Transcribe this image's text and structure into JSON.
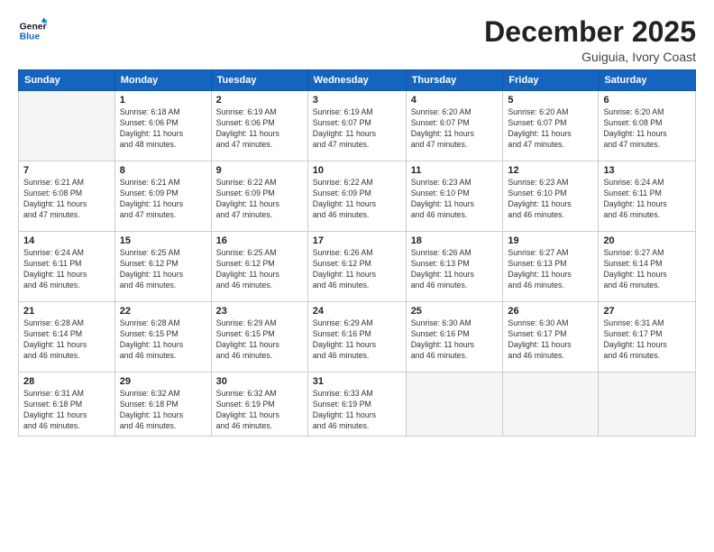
{
  "logo": {
    "line1": "General",
    "line2": "Blue"
  },
  "title": "December 2025",
  "subtitle": "Guiguia, Ivory Coast",
  "days_header": [
    "Sunday",
    "Monday",
    "Tuesday",
    "Wednesday",
    "Thursday",
    "Friday",
    "Saturday"
  ],
  "weeks": [
    [
      {
        "num": "",
        "info": ""
      },
      {
        "num": "1",
        "info": "Sunrise: 6:18 AM\nSunset: 6:06 PM\nDaylight: 11 hours\nand 48 minutes."
      },
      {
        "num": "2",
        "info": "Sunrise: 6:19 AM\nSunset: 6:06 PM\nDaylight: 11 hours\nand 47 minutes."
      },
      {
        "num": "3",
        "info": "Sunrise: 6:19 AM\nSunset: 6:07 PM\nDaylight: 11 hours\nand 47 minutes."
      },
      {
        "num": "4",
        "info": "Sunrise: 6:20 AM\nSunset: 6:07 PM\nDaylight: 11 hours\nand 47 minutes."
      },
      {
        "num": "5",
        "info": "Sunrise: 6:20 AM\nSunset: 6:07 PM\nDaylight: 11 hours\nand 47 minutes."
      },
      {
        "num": "6",
        "info": "Sunrise: 6:20 AM\nSunset: 6:08 PM\nDaylight: 11 hours\nand 47 minutes."
      }
    ],
    [
      {
        "num": "7",
        "info": "Sunrise: 6:21 AM\nSunset: 6:08 PM\nDaylight: 11 hours\nand 47 minutes."
      },
      {
        "num": "8",
        "info": "Sunrise: 6:21 AM\nSunset: 6:09 PM\nDaylight: 11 hours\nand 47 minutes."
      },
      {
        "num": "9",
        "info": "Sunrise: 6:22 AM\nSunset: 6:09 PM\nDaylight: 11 hours\nand 47 minutes."
      },
      {
        "num": "10",
        "info": "Sunrise: 6:22 AM\nSunset: 6:09 PM\nDaylight: 11 hours\nand 46 minutes."
      },
      {
        "num": "11",
        "info": "Sunrise: 6:23 AM\nSunset: 6:10 PM\nDaylight: 11 hours\nand 46 minutes."
      },
      {
        "num": "12",
        "info": "Sunrise: 6:23 AM\nSunset: 6:10 PM\nDaylight: 11 hours\nand 46 minutes."
      },
      {
        "num": "13",
        "info": "Sunrise: 6:24 AM\nSunset: 6:11 PM\nDaylight: 11 hours\nand 46 minutes."
      }
    ],
    [
      {
        "num": "14",
        "info": "Sunrise: 6:24 AM\nSunset: 6:11 PM\nDaylight: 11 hours\nand 46 minutes."
      },
      {
        "num": "15",
        "info": "Sunrise: 6:25 AM\nSunset: 6:12 PM\nDaylight: 11 hours\nand 46 minutes."
      },
      {
        "num": "16",
        "info": "Sunrise: 6:25 AM\nSunset: 6:12 PM\nDaylight: 11 hours\nand 46 minutes."
      },
      {
        "num": "17",
        "info": "Sunrise: 6:26 AM\nSunset: 6:12 PM\nDaylight: 11 hours\nand 46 minutes."
      },
      {
        "num": "18",
        "info": "Sunrise: 6:26 AM\nSunset: 6:13 PM\nDaylight: 11 hours\nand 46 minutes."
      },
      {
        "num": "19",
        "info": "Sunrise: 6:27 AM\nSunset: 6:13 PM\nDaylight: 11 hours\nand 46 minutes."
      },
      {
        "num": "20",
        "info": "Sunrise: 6:27 AM\nSunset: 6:14 PM\nDaylight: 11 hours\nand 46 minutes."
      }
    ],
    [
      {
        "num": "21",
        "info": "Sunrise: 6:28 AM\nSunset: 6:14 PM\nDaylight: 11 hours\nand 46 minutes."
      },
      {
        "num": "22",
        "info": "Sunrise: 6:28 AM\nSunset: 6:15 PM\nDaylight: 11 hours\nand 46 minutes."
      },
      {
        "num": "23",
        "info": "Sunrise: 6:29 AM\nSunset: 6:15 PM\nDaylight: 11 hours\nand 46 minutes."
      },
      {
        "num": "24",
        "info": "Sunrise: 6:29 AM\nSunset: 6:16 PM\nDaylight: 11 hours\nand 46 minutes."
      },
      {
        "num": "25",
        "info": "Sunrise: 6:30 AM\nSunset: 6:16 PM\nDaylight: 11 hours\nand 46 minutes."
      },
      {
        "num": "26",
        "info": "Sunrise: 6:30 AM\nSunset: 6:17 PM\nDaylight: 11 hours\nand 46 minutes."
      },
      {
        "num": "27",
        "info": "Sunrise: 6:31 AM\nSunset: 6:17 PM\nDaylight: 11 hours\nand 46 minutes."
      }
    ],
    [
      {
        "num": "28",
        "info": "Sunrise: 6:31 AM\nSunset: 6:18 PM\nDaylight: 11 hours\nand 46 minutes."
      },
      {
        "num": "29",
        "info": "Sunrise: 6:32 AM\nSunset: 6:18 PM\nDaylight: 11 hours\nand 46 minutes."
      },
      {
        "num": "30",
        "info": "Sunrise: 6:32 AM\nSunset: 6:19 PM\nDaylight: 11 hours\nand 46 minutes."
      },
      {
        "num": "31",
        "info": "Sunrise: 6:33 AM\nSunset: 6:19 PM\nDaylight: 11 hours\nand 46 minutes."
      },
      {
        "num": "",
        "info": ""
      },
      {
        "num": "",
        "info": ""
      },
      {
        "num": "",
        "info": ""
      }
    ]
  ]
}
